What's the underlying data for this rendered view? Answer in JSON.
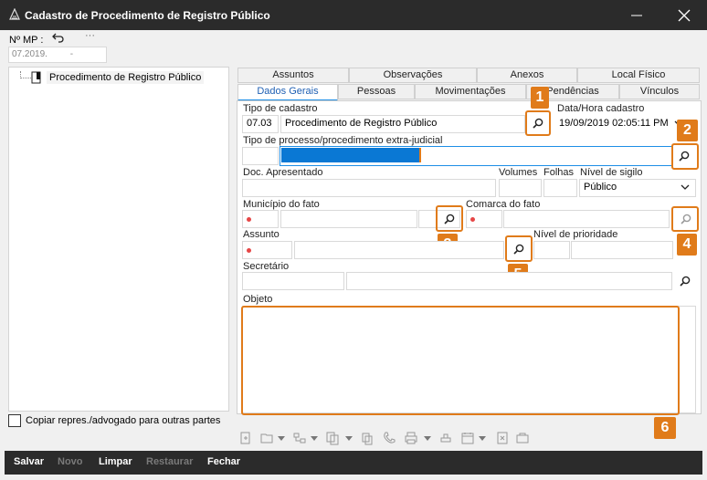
{
  "window": {
    "title": "Cadastro de Procedimento de Registro Público"
  },
  "mp": {
    "label": "Nº MP :",
    "value_part1": "07.2019.",
    "value_part2": "-"
  },
  "tree": {
    "items": [
      {
        "label": "Procedimento de Registro Público"
      }
    ]
  },
  "copy_checkbox": {
    "label": "Copiar repres./advogado para outras partes"
  },
  "tabs_row1": [
    {
      "label": "Assuntos"
    },
    {
      "label": "Observações"
    },
    {
      "label": "Anexos"
    },
    {
      "label": "Local Físico"
    }
  ],
  "tabs_row2": [
    {
      "label": "Dados Gerais",
      "active": true
    },
    {
      "label": "Pessoas"
    },
    {
      "label": "Movimentações"
    },
    {
      "label": "Pendências"
    },
    {
      "label": "Vínculos"
    }
  ],
  "form": {
    "tipo_cadastro_label": "Tipo de cadastro",
    "tipo_cadastro_code": "07.03",
    "tipo_cadastro_value": "Procedimento de Registro Público",
    "data_hora_label": "Data/Hora cadastro",
    "data_hora_value": "19/09/2019 02:05:11 PM",
    "tipo_processo_label": "Tipo de processo/procedimento extra-judicial",
    "doc_apresentado_label": "Doc. Apresentado",
    "volumes_label": "Volumes",
    "folhas_label": "Folhas",
    "nivel_sigilo_label": "Nível de sigilo",
    "nivel_sigilo_value": "Público",
    "municipio_label": "Município do fato",
    "comarca_label": "Comarca do fato",
    "assunto_label": "Assunto",
    "nivel_prioridade_label": "Nível de prioridade",
    "secretario_label": "Secretário",
    "objeto_label": "Objeto"
  },
  "badges": [
    "1",
    "2",
    "3",
    "4",
    "5",
    "6"
  ],
  "actions": {
    "salvar": "Salvar",
    "novo": "Novo",
    "limpar": "Limpar",
    "restaurar": "Restaurar",
    "fechar": "Fechar"
  },
  "colors": {
    "accent_orange": "#e07b1a",
    "selection_blue": "#0a78d4",
    "required_red": "#e64646",
    "titlebar": "#2b2b2b"
  }
}
